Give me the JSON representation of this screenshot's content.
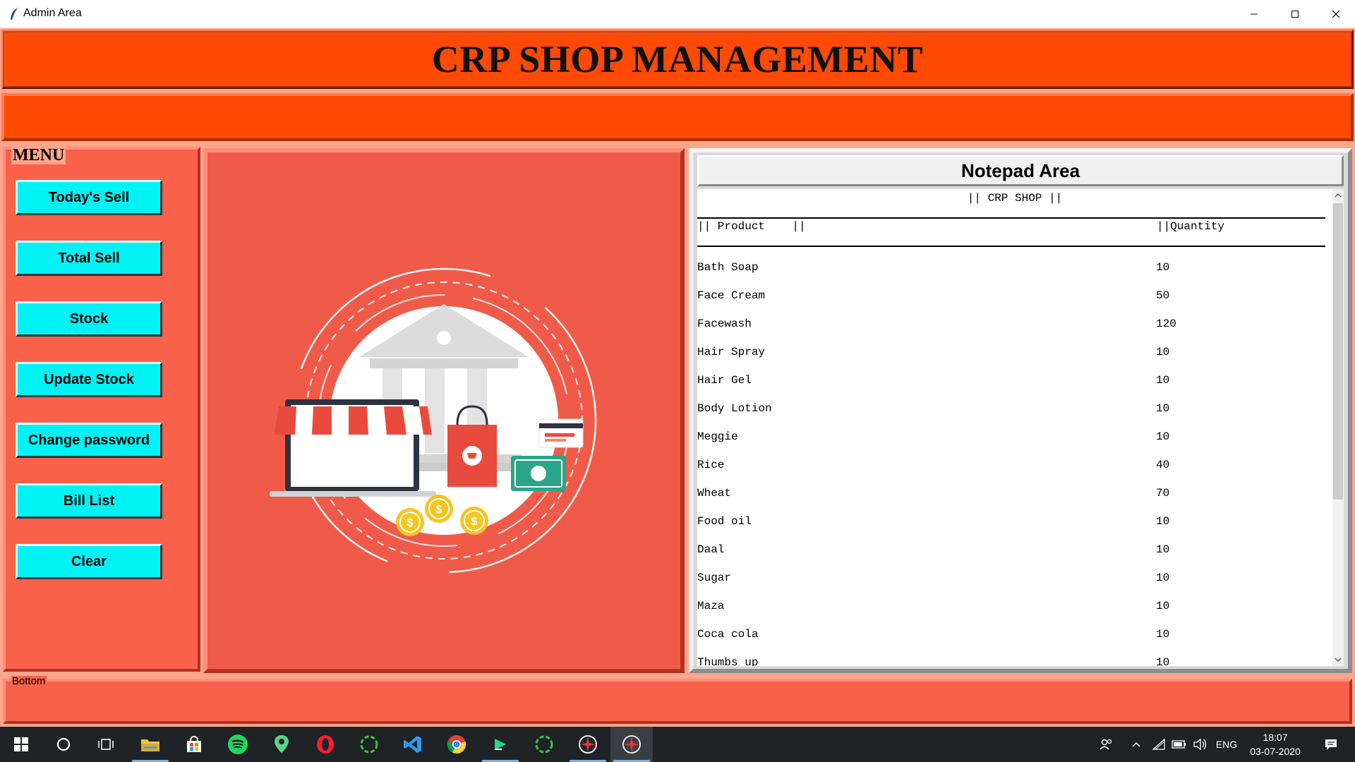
{
  "window": {
    "title": "Admin Area"
  },
  "header": {
    "title": "CRP SHOP MANAGEMENT"
  },
  "menu": {
    "legend": "MENU",
    "items": [
      {
        "label": "Today's Sell"
      },
      {
        "label": "Total Sell"
      },
      {
        "label": "Stock"
      },
      {
        "label": "Update Stock"
      },
      {
        "label": "Change password"
      },
      {
        "label": "Bill List"
      },
      {
        "label": "Clear"
      }
    ]
  },
  "notepad": {
    "title": "Notepad Area",
    "heading": "|| CRP SHOP ||",
    "col_product": "|| Product    ||",
    "col_quantity": "||Quantity",
    "rows": [
      {
        "name": "Bath Soap",
        "qty": "10"
      },
      {
        "name": "Face Cream",
        "qty": "50"
      },
      {
        "name": "Facewash",
        "qty": "120"
      },
      {
        "name": "Hair Spray",
        "qty": "10"
      },
      {
        "name": "Hair Gel",
        "qty": "10"
      },
      {
        "name": "Body Lotion",
        "qty": "10"
      },
      {
        "name": "Meggie",
        "qty": "10"
      },
      {
        "name": "Rice",
        "qty": "40"
      },
      {
        "name": "Wheat",
        "qty": "70"
      },
      {
        "name": "Food oil",
        "qty": "10"
      },
      {
        "name": "Daal",
        "qty": "10"
      },
      {
        "name": "Sugar",
        "qty": "10"
      },
      {
        "name": "Maza",
        "qty": "10"
      },
      {
        "name": "Coca cola",
        "qty": "10"
      },
      {
        "name": "Thumbs up",
        "qty": "10"
      }
    ]
  },
  "bottom": {
    "legend": "Bottom"
  },
  "taskbar": {
    "language": "ENG",
    "time": "18:07",
    "date": "03-07-2020",
    "apps": [
      "windows-start",
      "cortana",
      "task-view",
      "file-explorer",
      "microsoft-store",
      "spotify",
      "maps",
      "opera",
      "loader",
      "vs-code",
      "chrome",
      "pycharm",
      "loader-2",
      "python-tk",
      "python-tk-active"
    ]
  },
  "colors": {
    "header_bg": "#ff4a05",
    "menu_bg": "#f9614a",
    "menu_button": "#00f2f5",
    "image_bg": "#f05b49",
    "window_bg": "#ffa58c"
  }
}
